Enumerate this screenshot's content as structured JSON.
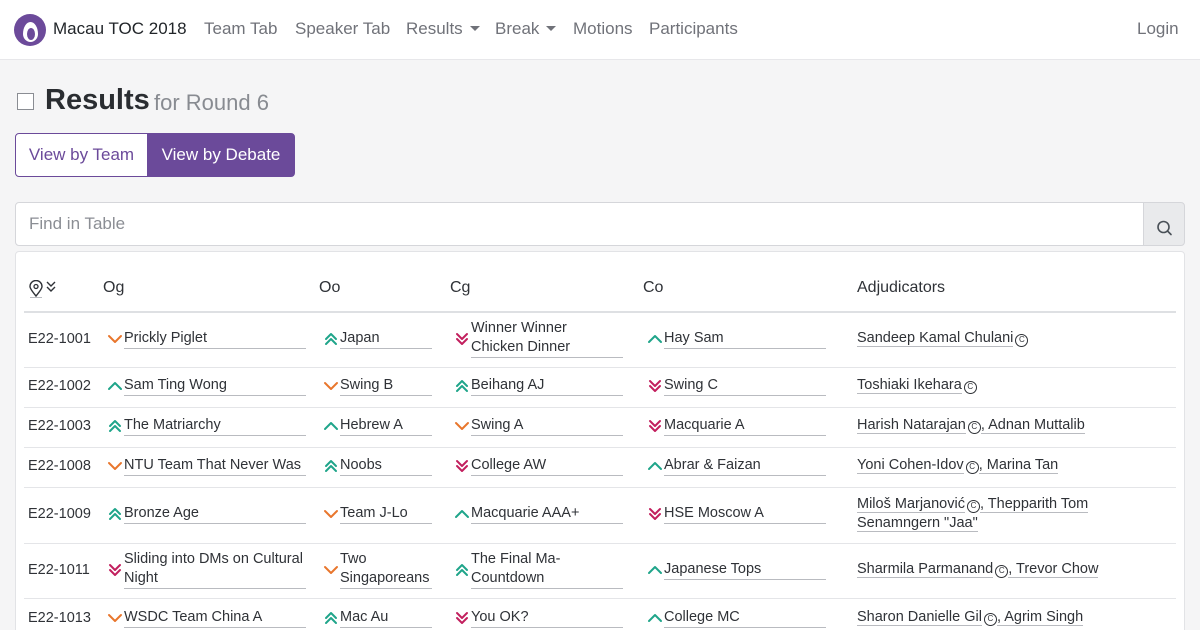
{
  "nav": {
    "brand": "Macau TOC 2018",
    "items": [
      "Team Tab",
      "Speaker Tab",
      "Results",
      "Break",
      "Motions",
      "Participants"
    ],
    "login": "Login"
  },
  "page": {
    "title": "Results",
    "subtitle": "for Round 6"
  },
  "view_buttons": {
    "team": "View by Team",
    "debate": "View by Debate"
  },
  "search": {
    "placeholder": "Find in Table"
  },
  "table": {
    "headers": [
      "Og",
      "Oo",
      "Cg",
      "Co",
      "Adjudicators"
    ],
    "rows": [
      {
        "room": "E22-1001",
        "teams": [
          {
            "name": "Prickly Piglet",
            "result": "down"
          },
          {
            "name": "Japan",
            "result": "double-up"
          },
          {
            "name": "Winner Winner Chicken Dinner",
            "result": "double-down"
          },
          {
            "name": "Hay Sam",
            "result": "up"
          }
        ],
        "adjudicators": [
          "Sandeep Kamal Chulani"
        ]
      },
      {
        "room": "E22-1002",
        "teams": [
          {
            "name": "Sam Ting Wong",
            "result": "up"
          },
          {
            "name": "Swing B",
            "result": "down"
          },
          {
            "name": "Beihang AJ",
            "result": "double-up"
          },
          {
            "name": "Swing C",
            "result": "double-down"
          }
        ],
        "adjudicators": [
          "Toshiaki Ikehara"
        ]
      },
      {
        "room": "E22-1003",
        "teams": [
          {
            "name": "The Matriarchy",
            "result": "double-up"
          },
          {
            "name": "Hebrew A",
            "result": "up"
          },
          {
            "name": "Swing A",
            "result": "down"
          },
          {
            "name": "Macquarie A",
            "result": "double-down"
          }
        ],
        "adjudicators": [
          "Harish Natarajan",
          "Adnan Muttalib"
        ]
      },
      {
        "room": "E22-1008",
        "teams": [
          {
            "name": "NTU Team That Never Was",
            "result": "down"
          },
          {
            "name": "Noobs",
            "result": "double-up"
          },
          {
            "name": "College AW",
            "result": "double-down"
          },
          {
            "name": "Abrar & Faizan",
            "result": "up"
          }
        ],
        "adjudicators": [
          "Yoni Cohen-Idov",
          "Marina Tan"
        ]
      },
      {
        "room": "E22-1009",
        "teams": [
          {
            "name": "Bronze Age",
            "result": "double-up"
          },
          {
            "name": "Team J-Lo",
            "result": "down"
          },
          {
            "name": "Macquarie AAA+",
            "result": "up"
          },
          {
            "name": "HSE Moscow A",
            "result": "double-down"
          }
        ],
        "adjudicators": [
          "Miloš Marjanović",
          "Thepparith Tom",
          "Senamngern \"Jaa\""
        ]
      },
      {
        "room": "E22-1011",
        "teams": [
          {
            "name": "Sliding into DMs on Cultural Night",
            "result": "double-down"
          },
          {
            "name": "Two Singaporeans",
            "result": "down"
          },
          {
            "name": "The Final Ma- Countdown",
            "result": "double-up"
          },
          {
            "name": "Japanese Tops",
            "result": "up"
          }
        ],
        "adjudicators": [
          "Sharmila Parmanand",
          "Trevor Chow"
        ]
      },
      {
        "room": "E22-1013",
        "teams": [
          {
            "name": "WSDC Team China A",
            "result": "down"
          },
          {
            "name": "Mac Au",
            "result": "double-up"
          },
          {
            "name": "You OK?",
            "result": "double-down"
          },
          {
            "name": "College MC",
            "result": "up"
          }
        ],
        "adjudicators": [
          "Sharon Danielle Gil",
          "Agrim Singh"
        ]
      }
    ]
  },
  "colors": {
    "accent": "#6b4a9a",
    "up": "#1fa58a",
    "down": "#e8762d",
    "double_down": "#c21f5e"
  }
}
